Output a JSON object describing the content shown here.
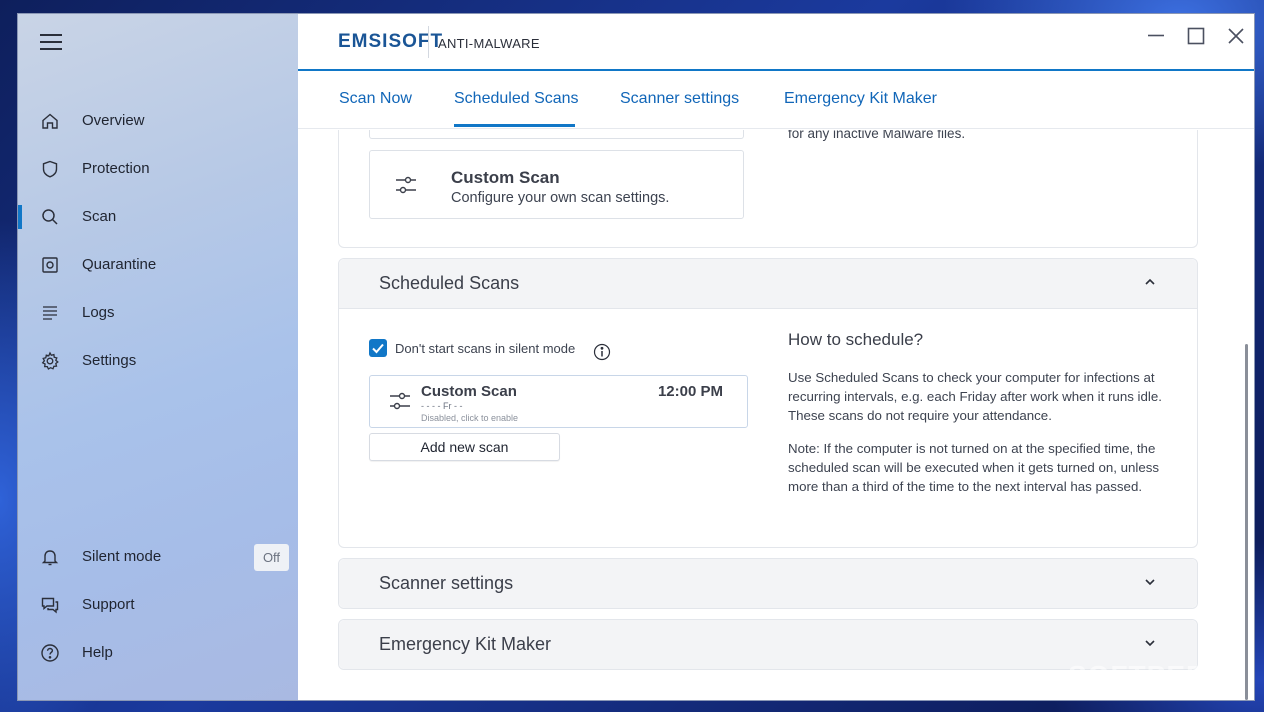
{
  "window": {
    "brand": "EMSISOFT",
    "product": "ANTI-MALWARE"
  },
  "sidebar": {
    "items": [
      {
        "label": "Overview",
        "icon": "home-icon"
      },
      {
        "label": "Protection",
        "icon": "shield-icon"
      },
      {
        "label": "Scan",
        "icon": "search-icon",
        "active": true
      },
      {
        "label": "Quarantine",
        "icon": "quarantine-icon"
      },
      {
        "label": "Logs",
        "icon": "logs-icon"
      },
      {
        "label": "Settings",
        "icon": "gear-icon"
      }
    ],
    "bottom": [
      {
        "label": "Silent mode",
        "icon": "bell-icon",
        "badge": "Off"
      },
      {
        "label": "Support",
        "icon": "chat-icon"
      },
      {
        "label": "Help",
        "icon": "help-icon"
      }
    ]
  },
  "tabs": [
    {
      "label": "Scan Now"
    },
    {
      "label": "Scheduled Scans",
      "active": true
    },
    {
      "label": "Scanner settings"
    },
    {
      "label": "Emergency Kit Maker"
    }
  ],
  "scan_now_panel": {
    "partial_text": "for any inactive Malware files.",
    "custom_scan": {
      "title": "Custom Scan",
      "description": "Configure your own scan settings."
    }
  },
  "scheduled_panel": {
    "title": "Scheduled Scans",
    "silent_checkbox": {
      "label": "Don't start scans in silent mode",
      "checked": true
    },
    "scheduled_item": {
      "title": "Custom Scan",
      "time": "12:00 PM",
      "days": "- - - - Fr - -",
      "status": "Disabled, click to enable"
    },
    "add_button": "Add new scan",
    "help_title": "How to schedule?",
    "help_p1": "Use Scheduled Scans to check your computer for infections at recurring intervals, e.g. each Friday after work when it runs idle. These scans do not require your attendance.",
    "help_p2": "Note: If the computer is not turned on at the specified time, the scheduled scan will be executed when it gets turned on, unless more than a third of the time to the next interval has passed."
  },
  "collapsed_panels": [
    {
      "title": "Scanner settings"
    },
    {
      "title": "Emergency Kit Maker"
    }
  ],
  "watermark": "SOFTPEDIA",
  "colors": {
    "accent": "#1177c7",
    "link": "#1166b8"
  }
}
